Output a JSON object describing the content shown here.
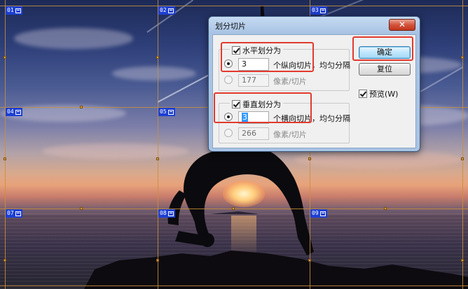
{
  "dialog": {
    "title": "划分切片",
    "close_glyph": "✕",
    "horizontal": {
      "label": "水平划分为",
      "checked": true,
      "count_value": "3",
      "count_suffix": "个纵向切片，均匀分隔",
      "pixel_value": "177",
      "pixel_suffix": "像素/切片"
    },
    "vertical": {
      "label": "垂直划分为",
      "checked": true,
      "count_value": "3",
      "count_suffix": "个横向切片，均匀分隔",
      "pixel_value": "266",
      "pixel_suffix": "像素/切片"
    },
    "ok_label": "确定",
    "reset_label": "复位",
    "preview_label": "预览(W)",
    "preview_checked": true
  },
  "slices": {
    "labels": [
      "01",
      "02",
      "03",
      "04",
      "05",
      "06",
      "07",
      "08",
      "09"
    ],
    "icon": "slice-image-icon"
  },
  "colors": {
    "highlight": "#e23a2e",
    "slice_line": "#c8903a",
    "slice_label_bg": "#1c3fd2",
    "dialog_frame": "#a9c4e4"
  }
}
